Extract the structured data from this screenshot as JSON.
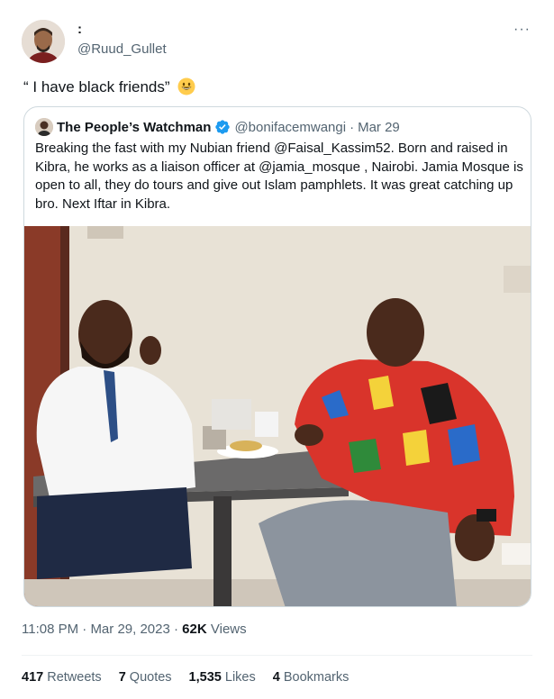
{
  "author": {
    "display_name": ":",
    "handle": "@Ruud_Gullet"
  },
  "tweet": {
    "text": "“ I have black friends”",
    "emoji": "grinning-face-emoji"
  },
  "quoted_tweet": {
    "display_name": "The People’s Watchman",
    "handle": "@bonifacemwangi",
    "separator": "·",
    "date": "Mar 29",
    "text": "Breaking the fast with my Nubian friend @Faisal_Kassim52.  Born and raised in Kibra, he works as a liaison officer at @jamia_mosque , Nairobi. Jamia Mosque is open to all, they do tours and give out Islam pamphlets. It was great catching up bro. Next Iftar in Kibra."
  },
  "meta": {
    "time": "11:08 PM",
    "separator": "·",
    "date": "Mar 29, 2023",
    "views_count": "62K",
    "views_label": "Views"
  },
  "stats": {
    "retweets_count": "417",
    "retweets_label": "Retweets",
    "quotes_count": "7",
    "quotes_label": "Quotes",
    "likes_count": "1,535",
    "likes_label": "Likes",
    "bookmarks_count": "4",
    "bookmarks_label": "Bookmarks"
  },
  "more_label": "···",
  "colors": {
    "text": "#0f1419",
    "secondary": "#536471",
    "verified": "#1d9bf0",
    "border": "#cfd9de"
  }
}
